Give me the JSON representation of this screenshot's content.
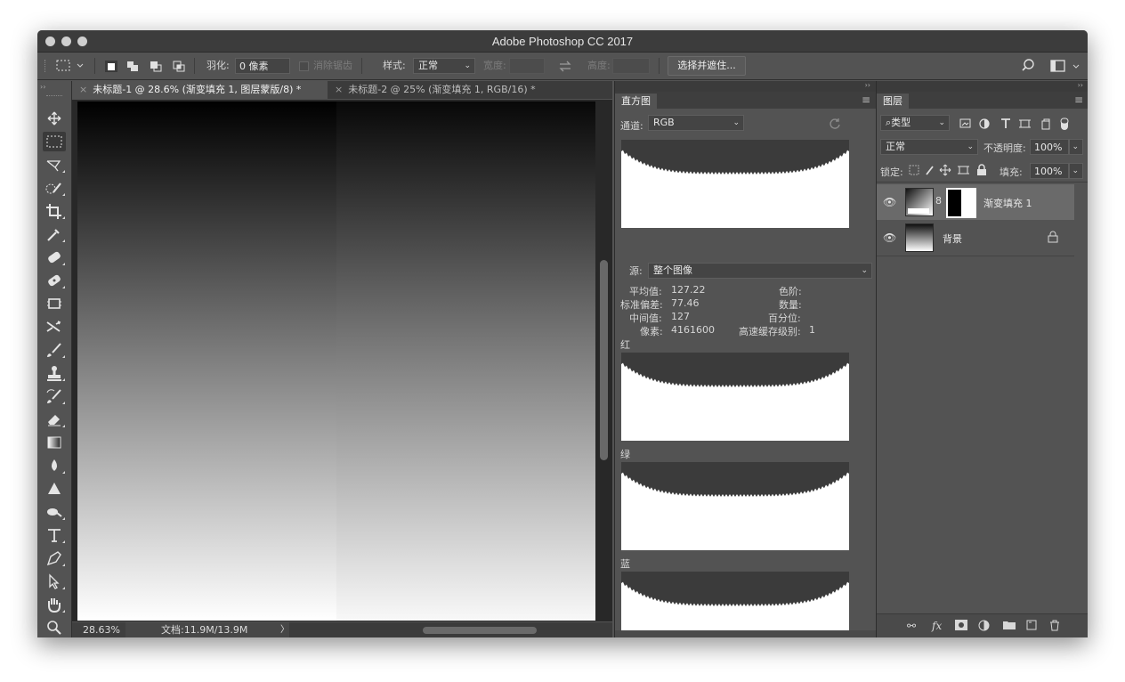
{
  "window": {
    "title": "Adobe Photoshop CC 2017"
  },
  "options_bar": {
    "feather_label": "羽化:",
    "feather_value": "0 像素",
    "anti_alias_label": "消除锯齿",
    "style_label": "样式:",
    "style_value": "正常",
    "width_label": "宽度:",
    "height_label": "高度:",
    "select_mask_button": "选择并遮住..."
  },
  "tabs": [
    {
      "label": "未标题-1 @ 28.6% (渐变填充 1, 图层蒙版/8) *",
      "active": true
    },
    {
      "label": "未标题-2 @ 25% (渐变填充 1, RGB/16) *",
      "active": false
    }
  ],
  "status": {
    "zoom": "28.63%",
    "doc": "文档:11.9M/13.9M",
    "arrow": "〉"
  },
  "histogram": {
    "panel_title": "直方图",
    "channel_label": "通道:",
    "channel_value": "RGB",
    "source_label": "源:",
    "source_value": "整个图像",
    "stats": {
      "mean_label": "平均值:",
      "mean_value": "127.22",
      "stddev_label": "标准偏差:",
      "stddev_value": "77.46",
      "median_label": "中间值:",
      "median_value": "127",
      "pixels_label": "像素:",
      "pixels_value": "4161600",
      "level_label": "色阶:",
      "count_label": "数量:",
      "percentile_label": "百分位:",
      "cache_label": "高速缓存级别:",
      "cache_value": "1"
    },
    "channels": {
      "red": "红",
      "green": "绿",
      "blue": "蓝"
    }
  },
  "layers": {
    "panel_title": "图层",
    "filter_kind": "类型",
    "blend_mode": "正常",
    "opacity_label": "不透明度:",
    "opacity_value": "100%",
    "lock_label": "锁定:",
    "fill_label": "填充:",
    "fill_value": "100%",
    "items": [
      {
        "name": "渐变填充 1",
        "selected": true
      },
      {
        "name": "背景",
        "selected": false,
        "locked": true
      }
    ]
  },
  "icons": {
    "tools": [
      "move-icon",
      "marquee-icon",
      "lasso-icon",
      "quick-select-icon",
      "crop-icon",
      "eyedropper-icon",
      "healing-icon",
      "patch-icon",
      "frame-icon",
      "content-aware-move-icon",
      "brush-icon",
      "stamp-icon",
      "history-brush-icon",
      "eraser-icon",
      "gradient-icon",
      "blur-icon",
      "sharpen-icon",
      "dodge-icon",
      "type-icon",
      "pen-icon",
      "path-select-icon",
      "hand-icon",
      "zoom-icon"
    ]
  },
  "colors": {
    "panel": "#535353",
    "dark": "#3c3c3c",
    "canvas_bg": "#282828"
  }
}
